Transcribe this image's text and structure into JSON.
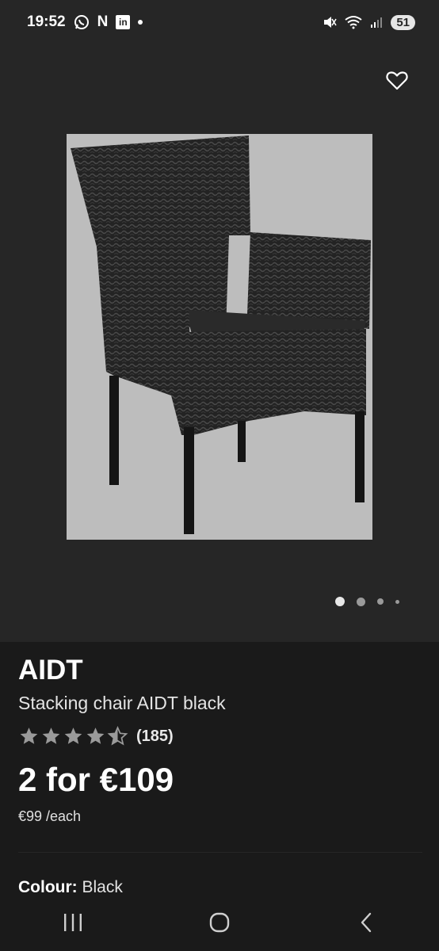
{
  "status_bar": {
    "time": "19:52",
    "notification_n": "N",
    "linkedin": "in",
    "battery": "51"
  },
  "product": {
    "brand": "AIDT",
    "name": "Stacking chair AIDT black",
    "rating_stars": 4.5,
    "rating_count": "(185)",
    "price_offer": "2 for €109",
    "unit_price": "€99 /each",
    "colour_label": "Colour:",
    "colour_value": "Black"
  },
  "gallery": {
    "image_count": 4,
    "active_index": 0
  },
  "icons": {
    "favourite": "heart-outline-icon",
    "nav_recents": "recents-icon",
    "nav_home": "home-icon",
    "nav_back": "back-icon"
  },
  "colors": {
    "background": "#1a1a1a",
    "panel": "#262626",
    "image_bg": "#bdbdbd",
    "star": "#9a9a9a"
  }
}
